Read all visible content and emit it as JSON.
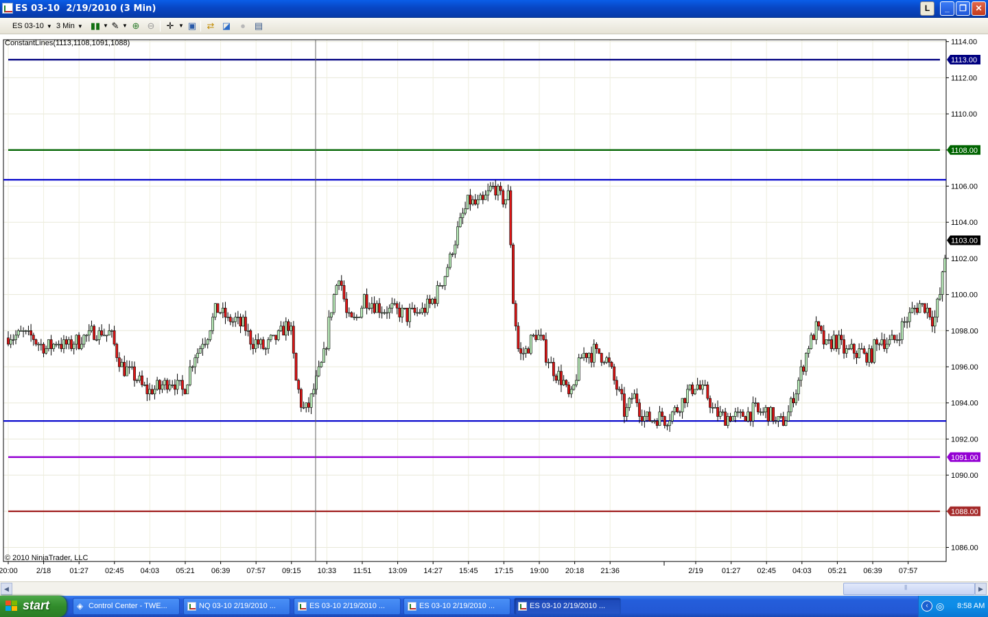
{
  "window": {
    "title": "ES 03-10  2/19/2010 (3 Min)",
    "l_button": "L"
  },
  "toolbar": {
    "instrument": "ES 03-10",
    "interval": "3 Min"
  },
  "chart": {
    "indicator_label": "ConstantLines(1113,1108,1091,1088)",
    "copyright": "© 2010 NinjaTrader, LLC",
    "price_ticks": [
      "1114.00",
      "1112.00",
      "1110.00",
      "1108.00",
      "1106.00",
      "1104.00",
      "1102.00",
      "1100.00",
      "1098.00",
      "1096.00",
      "1094.00",
      "1092.00",
      "1090.00",
      "1088.00",
      "1086.00"
    ],
    "time_ticks": [
      "20:00",
      "2/18",
      "01:27",
      "02:45",
      "04:03",
      "05:21",
      "06:39",
      "07:57",
      "09:15",
      "10:33",
      "11:51",
      "13:09",
      "14:27",
      "15:45",
      "17:15",
      "19:00",
      "20:18",
      "21:36",
      "2/19",
      "01:27",
      "02:45",
      "04:03",
      "05:21",
      "06:39",
      "07:57"
    ],
    "price_badges": [
      {
        "label": "1113.00",
        "color": "#000080"
      },
      {
        "label": "1108.00",
        "color": "#006400"
      },
      {
        "label": "1103.00",
        "color": "#000000"
      },
      {
        "label": "1091.00",
        "color": "#9400d3"
      },
      {
        "label": "1088.00",
        "color": "#a52a2a"
      }
    ]
  },
  "chart_data": {
    "type": "candlestick",
    "instrument": "ES 03-10",
    "interval": "3 Min",
    "ylim": [
      1085.5,
      1114.2
    ],
    "constant_lines": [
      {
        "value": 1113,
        "color": "#000080"
      },
      {
        "value": 1108,
        "color": "#006400"
      },
      {
        "value": 1091,
        "color": "#9400d3"
      },
      {
        "value": 1088,
        "color": "#a52a2a"
      }
    ],
    "drawn_lines": [
      {
        "value": 1106.35,
        "color": "#0000cc"
      },
      {
        "value": 1093.0,
        "color": "#0000cc"
      }
    ],
    "last_price": 1103.0,
    "price_path": [
      [
        0,
        1097.6
      ],
      [
        20,
        1097.9
      ],
      [
        40,
        1097.5
      ],
      [
        55,
        1097.0
      ],
      [
        70,
        1097.4
      ],
      [
        90,
        1097.2
      ],
      [
        110,
        1097.6
      ],
      [
        130,
        1097.9
      ],
      [
        150,
        1097.8
      ],
      [
        165,
        1096.0
      ],
      [
        185,
        1095.4
      ],
      [
        205,
        1094.6
      ],
      [
        220,
        1094.8
      ],
      [
        240,
        1095.3
      ],
      [
        255,
        1094.6
      ],
      [
        270,
        1096.5
      ],
      [
        290,
        1097.8
      ],
      [
        305,
        1099.3
      ],
      [
        320,
        1098.6
      ],
      [
        340,
        1098.4
      ],
      [
        355,
        1097.5
      ],
      [
        375,
        1097.0
      ],
      [
        395,
        1097.8
      ],
      [
        410,
        1098.5
      ],
      [
        420,
        1095.0
      ],
      [
        432,
        1093.4
      ],
      [
        445,
        1094.6
      ],
      [
        460,
        1096.5
      ],
      [
        470,
        1099.2
      ],
      [
        482,
        1101.2
      ],
      [
        495,
        1098.6
      ],
      [
        505,
        1098.5
      ],
      [
        520,
        1099.9
      ],
      [
        540,
        1099.2
      ],
      [
        560,
        1099.2
      ],
      [
        580,
        1098.8
      ],
      [
        600,
        1099.0
      ],
      [
        620,
        1099.7
      ],
      [
        640,
        1101.5
      ],
      [
        655,
        1103.5
      ],
      [
        670,
        1105.2
      ],
      [
        690,
        1105.0
      ],
      [
        708,
        1106.0
      ],
      [
        720,
        1105.2
      ],
      [
        730,
        1105.6
      ],
      [
        735,
        1100.0
      ],
      [
        745,
        1096.5
      ],
      [
        760,
        1097.2
      ],
      [
        770,
        1098.0
      ],
      [
        790,
        1096.2
      ],
      [
        810,
        1095.0
      ],
      [
        820,
        1094.2
      ],
      [
        835,
        1096.6
      ],
      [
        855,
        1096.8
      ],
      [
        870,
        1096.6
      ],
      [
        885,
        1095.0
      ],
      [
        900,
        1093.3
      ],
      [
        912,
        1094.5
      ],
      [
        925,
        1093.2
      ],
      [
        945,
        1093.2
      ],
      [
        965,
        1093.2
      ],
      [
        985,
        1094.2
      ],
      [
        1000,
        1095.0
      ],
      [
        1015,
        1094.6
      ],
      [
        1030,
        1093.4
      ],
      [
        1050,
        1093.2
      ],
      [
        1070,
        1093.3
      ],
      [
        1090,
        1093.5
      ],
      [
        1110,
        1093.4
      ],
      [
        1122,
        1092.8
      ],
      [
        1135,
        1093.3
      ],
      [
        1150,
        1095.0
      ],
      [
        1165,
        1097.0
      ],
      [
        1180,
        1098.2
      ],
      [
        1192,
        1097.0
      ],
      [
        1205,
        1097.6
      ],
      [
        1220,
        1096.8
      ],
      [
        1240,
        1096.8
      ],
      [
        1255,
        1096.5
      ],
      [
        1270,
        1097.5
      ],
      [
        1290,
        1097.3
      ],
      [
        1305,
        1098.5
      ],
      [
        1320,
        1099.2
      ],
      [
        1335,
        1099.5
      ],
      [
        1350,
        1098.5
      ],
      [
        1360,
        1100.5
      ],
      [
        1368,
        1103.0
      ]
    ]
  }
}
